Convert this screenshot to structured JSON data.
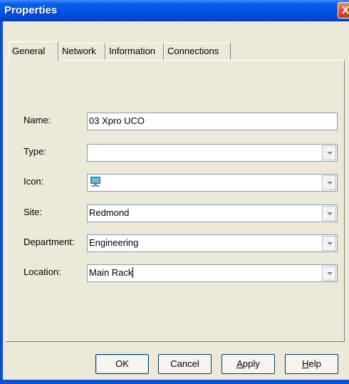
{
  "window": {
    "title": "Properties",
    "close_glyph": "X"
  },
  "tabs": [
    {
      "label": "General",
      "active": true
    },
    {
      "label": "Network",
      "active": false
    },
    {
      "label": "Information",
      "active": false
    },
    {
      "label": "Connections",
      "active": false
    }
  ],
  "form": {
    "name": {
      "label": "Name:",
      "value": "03 Xpro UCO"
    },
    "type": {
      "label": "Type:",
      "value": ""
    },
    "icon": {
      "label": "Icon:",
      "value": "",
      "icon": "computer-monitor-icon"
    },
    "site": {
      "label": "Site:",
      "value": "Redmond"
    },
    "department": {
      "label": "Department:",
      "value": "Engineering"
    },
    "location": {
      "label": "Location:",
      "value": "Main Rack"
    }
  },
  "buttons": {
    "ok": "OK",
    "cancel": "Cancel",
    "apply_accel": "A",
    "apply_rest": "pply",
    "help_accel": "H",
    "help_rest": "elp"
  },
  "colors": {
    "titlebar": "#0055e5",
    "dialog_bg": "#ece9d8",
    "close_button": "#d84a28",
    "field_border": "#7f9db9"
  }
}
